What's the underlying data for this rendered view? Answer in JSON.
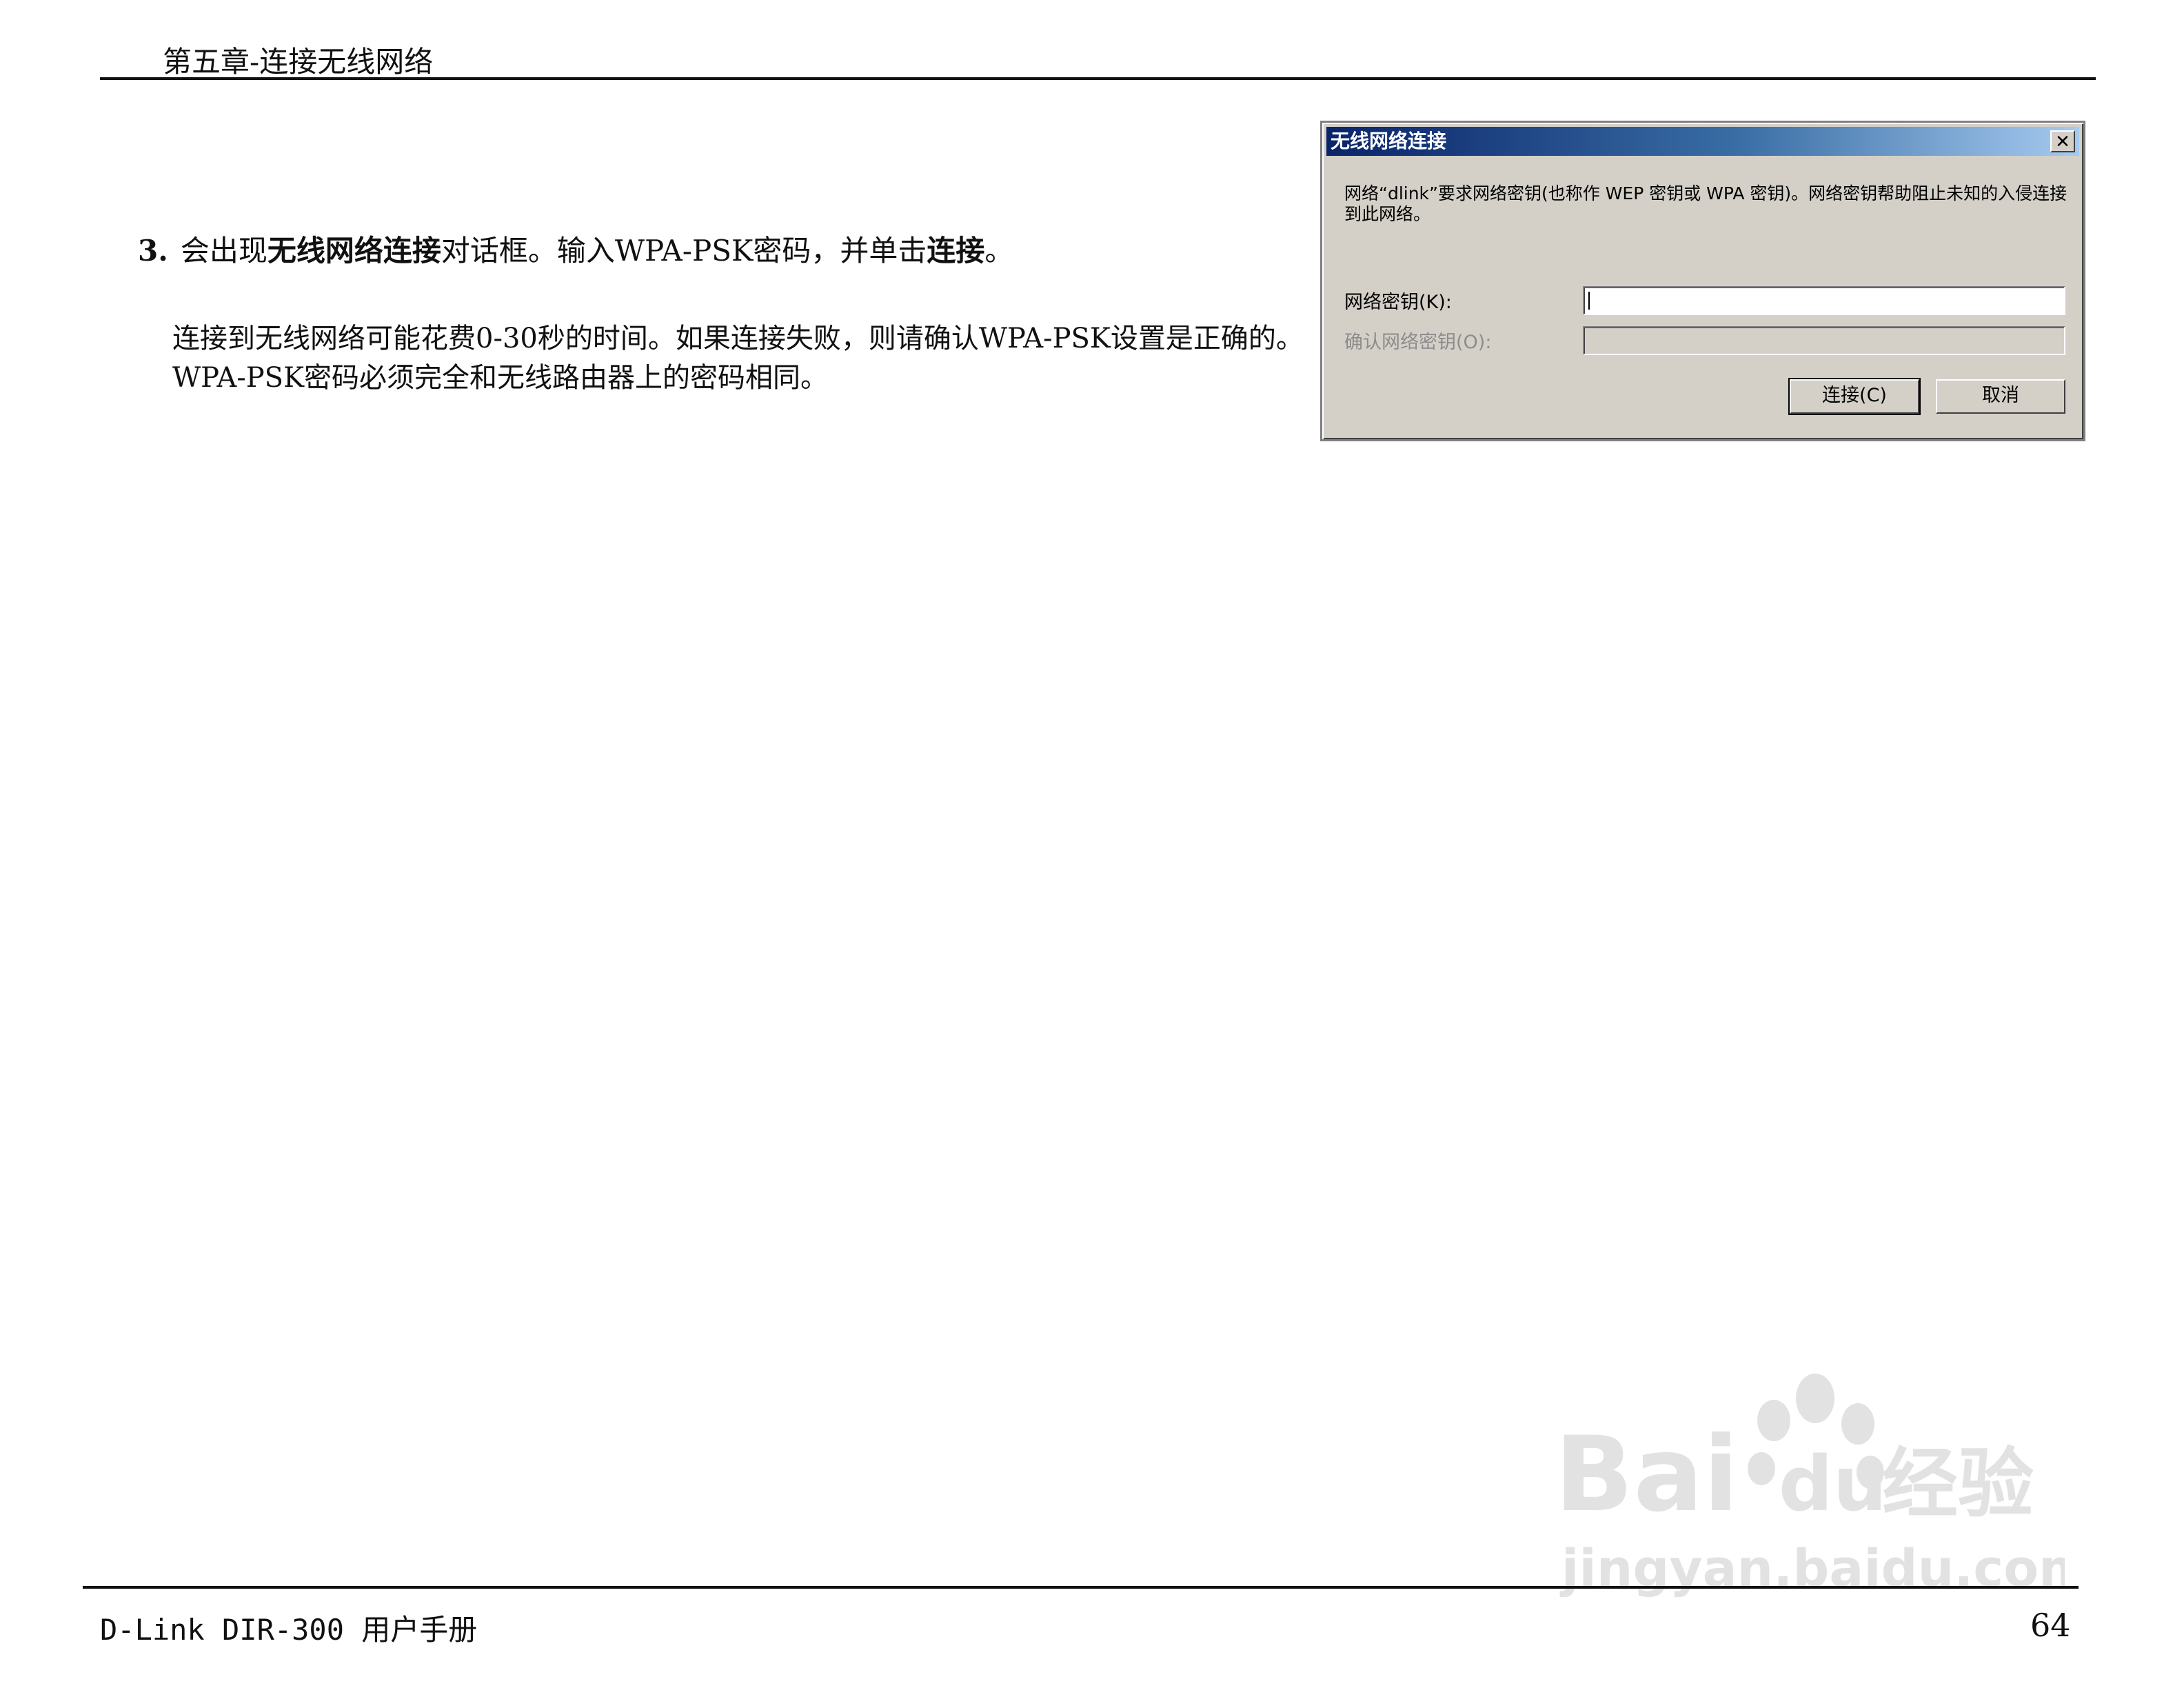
{
  "header": {
    "title": "第五章-连接无线网络"
  },
  "step": {
    "number": "3.",
    "text_1": "会出现",
    "bold_1": "无线网络连接",
    "text_2": "对话框。输入WPA-PSK密码，并单击",
    "bold_2": "连接",
    "text_3": "。"
  },
  "note": {
    "line_1": "连接到无线网络可能花费0-30秒的时间。如果连接失败，则请确认WPA-PSK设置是正确的。",
    "line_2": "WPA-PSK密码必须完全和无线路由器上的密码相同。"
  },
  "dialog": {
    "title": "无线网络连接",
    "close_glyph": "✕",
    "message": "网络“dlink”要求网络密钥(也称作 WEP 密钥或 WPA 密钥)。网络密钥帮助阻止未知的入侵连接到此网络。",
    "key_label": "网络密钥(K):",
    "confirm_label": "确认网络密钥(O):",
    "key_value": "",
    "confirm_value": "",
    "connect_button": "连接(C)",
    "cancel_button": "取消"
  },
  "footer": {
    "left": "D-Link DIR-300 用户手册",
    "page_number": "64"
  },
  "watermark": {
    "brand": "Bai",
    "brand_2": "du",
    "suffix": "经验",
    "url": "jingyan.baidu.com"
  }
}
